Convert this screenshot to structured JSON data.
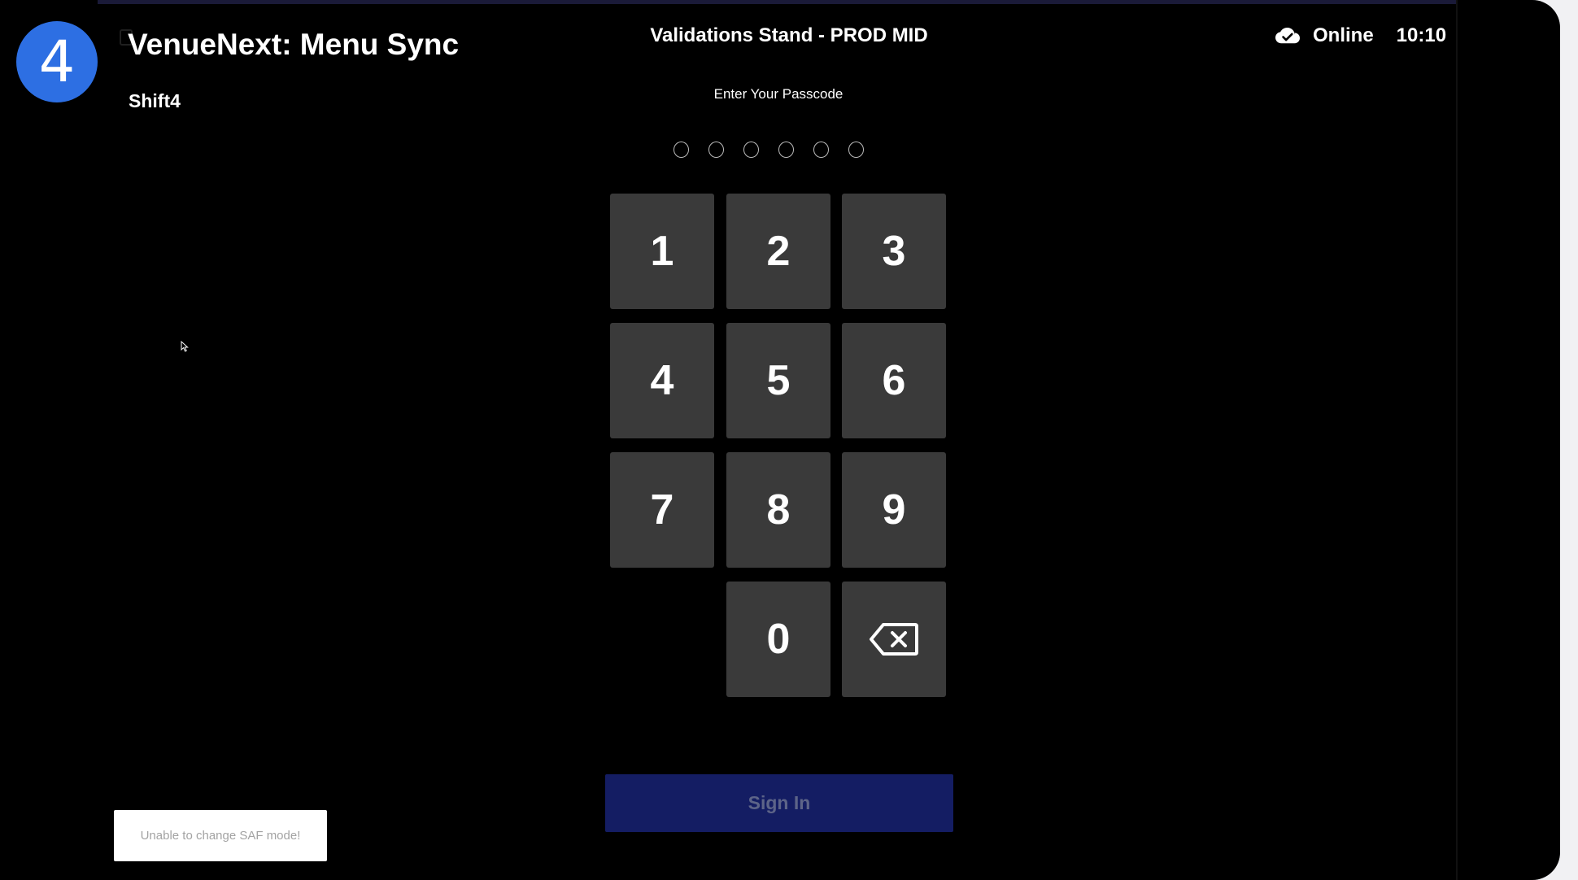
{
  "header": {
    "brand_number": "4",
    "app_title": "VenueNext: Menu Sync",
    "app_subtitle": "Shift4",
    "stand_name": "Validations Stand - PROD MID",
    "connection_status": "Online",
    "time": "10:10"
  },
  "passcode": {
    "prompt": "Enter Your Passcode",
    "dot_count": 6,
    "entered": 0
  },
  "keypad": {
    "keys": [
      "1",
      "2",
      "3",
      "4",
      "5",
      "6",
      "7",
      "8",
      "9",
      "0"
    ],
    "backspace_icon": "backspace-icon"
  },
  "actions": {
    "sign_in_label": "Sign In"
  },
  "toast": {
    "message": "Unable to change SAF mode!"
  },
  "icons": {
    "status": "cloud-check-icon",
    "pointer": "cursor-icon"
  },
  "colors": {
    "background": "#000000",
    "brand": "#2d6fe3",
    "key": "#3a3a3a",
    "sign_in_disabled": "#141d63",
    "sign_in_text": "#5d6488"
  }
}
